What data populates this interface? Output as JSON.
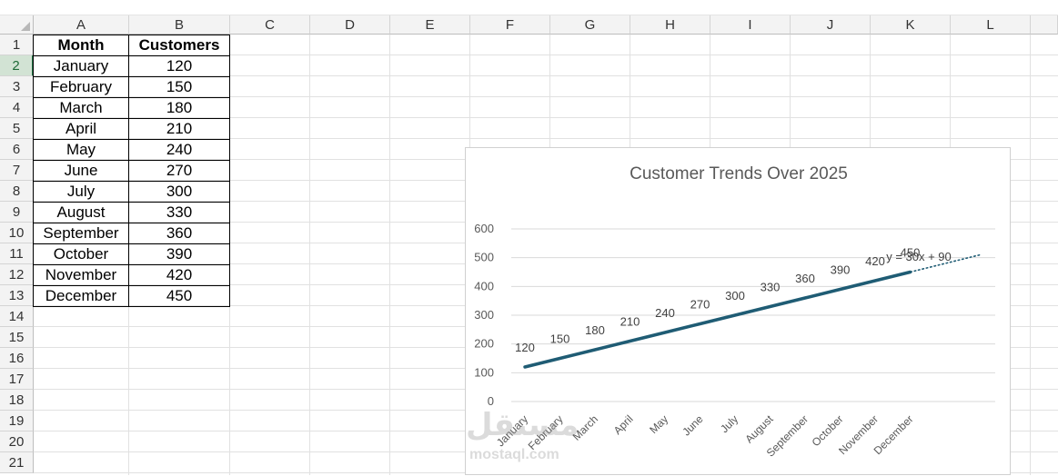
{
  "columns": [
    "A",
    "B",
    "C",
    "D",
    "E",
    "F",
    "G",
    "H",
    "I",
    "J",
    "K",
    "L"
  ],
  "rows": [
    "1",
    "2",
    "3",
    "4",
    "5",
    "6",
    "7",
    "8",
    "9",
    "10",
    "11",
    "12",
    "13",
    "14",
    "15",
    "16",
    "17",
    "18",
    "19",
    "20",
    "21"
  ],
  "selected_row": 2,
  "table": {
    "headers": [
      "Month",
      "Customers"
    ],
    "rows": [
      [
        "January",
        "120"
      ],
      [
        "February",
        "150"
      ],
      [
        "March",
        "180"
      ],
      [
        "April",
        "210"
      ],
      [
        "May",
        "240"
      ],
      [
        "June",
        "270"
      ],
      [
        "July",
        "300"
      ],
      [
        "August",
        "330"
      ],
      [
        "September",
        "360"
      ],
      [
        "October",
        "390"
      ],
      [
        "November",
        "420"
      ],
      [
        "December",
        "450"
      ]
    ]
  },
  "chart_data": {
    "type": "line",
    "title": "Customer Trends Over 2025",
    "categories": [
      "January",
      "February",
      "March",
      "April",
      "May",
      "June",
      "July",
      "August",
      "September",
      "October",
      "November",
      "December"
    ],
    "series": [
      {
        "values": [
          120,
          150,
          180,
          210,
          240,
          270,
          300,
          330,
          360,
          390,
          420,
          450
        ],
        "color": "#1f5c74"
      }
    ],
    "trendline": {
      "equation": "y = 30x + 90",
      "style": "dotted",
      "color": "#1f5c74",
      "forward_periods": 2
    },
    "ylim": [
      0,
      600
    ],
    "yticks": [
      0,
      100,
      200,
      300,
      400,
      500,
      600
    ],
    "grid": true,
    "data_labels": true,
    "xlabel": "",
    "ylabel": ""
  },
  "watermark": {
    "arabic": "مستقل",
    "latin": "mostaql.com"
  }
}
